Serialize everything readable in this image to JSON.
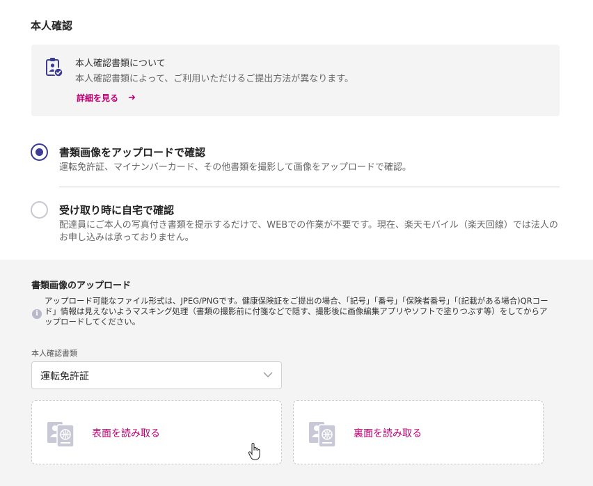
{
  "section_title": "本人確認",
  "info_card": {
    "title": "本人確認書類について",
    "description": "本人確認書類によって、ご利用いただけるご提出方法が異なります。",
    "link_label": "詳細を見る",
    "link_arrow": "➜"
  },
  "options": [
    {
      "title": "書類画像をアップロードで確認",
      "description": "運転免許証、マイナンバーカード、その他書類を撮影して画像をアップロードで確認。",
      "selected": true
    },
    {
      "title": "受け取り時に自宅で確認",
      "description": "配達員にご本人の写真付き書類を提示するだけで、WEBでの作業が不要です。現在、楽天モバイル（楽天回線）では法人のお申し込みは承っておりません。",
      "selected": false
    }
  ],
  "upload": {
    "title": "書類画像のアップロード",
    "notice_icon": "i",
    "notice": "アップロード可能なファイル形式は、JPEG/PNGです。健康保険証をご提出の場合、「記号」「番号」「保険者番号」「(記載がある場合)QRコード」情報は見えないようマスキング処理（書類の撮影前に付箋などで隠す、撮影後に画像編集アプリやソフトで塗りつぶす等）をしてからアップロードしてください。",
    "select_label": "本人確認書類",
    "select_value": "運転免許証",
    "front_label": "表面を読み取る",
    "back_label": "裏面を読み取る"
  },
  "colors": {
    "accent": "#bf0073",
    "radio_selected": "#3c3c96",
    "icon_gray": "#c8c8d6",
    "section_bg": "#f4f4f4"
  }
}
